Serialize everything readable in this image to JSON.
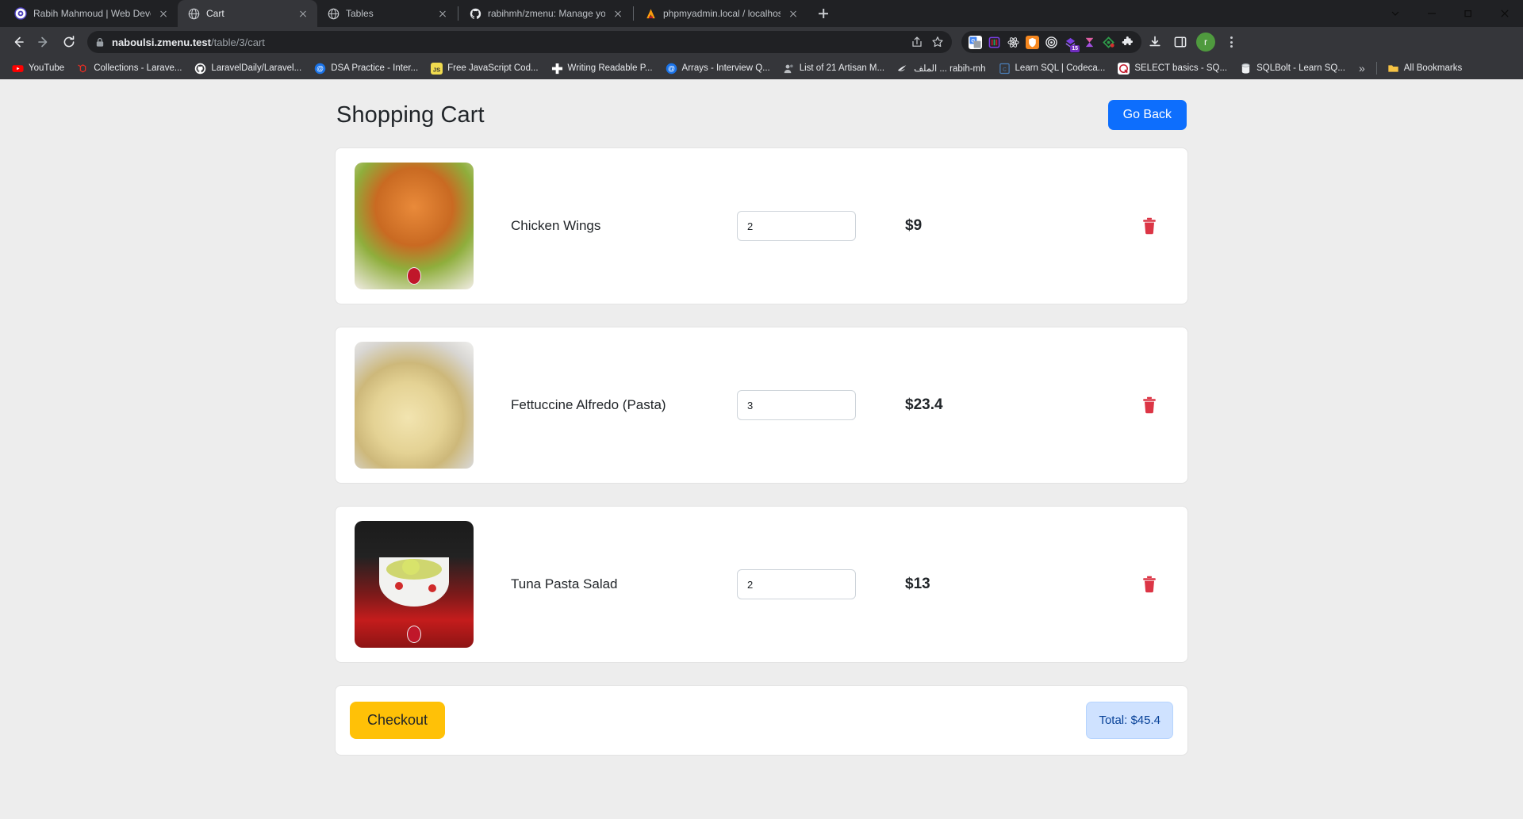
{
  "browser": {
    "tabs": [
      {
        "title": "Rabih Mahmoud | Web Develop",
        "favicon": "globe-purple-icon",
        "active": false
      },
      {
        "title": "Cart",
        "favicon": "globe-icon",
        "active": true
      },
      {
        "title": "Tables",
        "favicon": "globe-icon",
        "active": false
      },
      {
        "title": "rabihmh/zmenu: Manage your re",
        "favicon": "github-icon",
        "active": false
      },
      {
        "title": "phpmyadmin.local / localhost / t",
        "favicon": "phpmyadmin-icon",
        "active": false
      }
    ],
    "new_tab_label": "+",
    "window_controls": [
      "tab-search-chevron",
      "minimize",
      "maximize",
      "close"
    ],
    "nav": {
      "back": "back-arrow",
      "forward": "forward-arrow",
      "reload": "reload-icon"
    },
    "omnibox": {
      "lock": "lock-icon",
      "host": "naboulsi.zmenu.test",
      "path": "/table/3/cart",
      "share_icon": "share-icon",
      "bookmark_icon": "star-icon"
    },
    "extensions": [
      {
        "name": "google-translate-extension",
        "color": "#ffffff",
        "glyph": "G"
      },
      {
        "name": "purple-devtools-extension",
        "color": "#6f2dbd",
        "glyph": ""
      },
      {
        "name": "react-devtools-extension",
        "color": "#20232a",
        "glyph": ""
      },
      {
        "name": "orange-shield-extension",
        "color": "#f5871f",
        "glyph": ""
      },
      {
        "name": "target-ring-extension",
        "color": "#1a1a1a",
        "glyph": ""
      },
      {
        "name": "purple-badge-extension",
        "color": "#7b3fe4",
        "glyph": "",
        "badge": "15"
      },
      {
        "name": "hourglass-extension",
        "color": "#8a4fe0",
        "glyph": ""
      },
      {
        "name": "diamond-dot-extension",
        "color": "#2e7d32",
        "glyph": ""
      },
      {
        "name": "puzzle-extensions-menu",
        "color": "#e8eaed",
        "glyph": ""
      }
    ],
    "toolbar_right": {
      "download_icon": "download-icon",
      "sidepanel_icon": "side-panel-icon",
      "profile_initial": "r",
      "menu_icon": "kebab-menu-icon"
    },
    "bookmarks": [
      {
        "label": "YouTube",
        "icon": "youtube-icon",
        "color": "#ff0000"
      },
      {
        "label": "Collections - Larave...",
        "icon": "laravel-icon",
        "color": "#ff2d20"
      },
      {
        "label": "LaravelDaily/Laravel...",
        "icon": "github-icon",
        "color": "#ffffff"
      },
      {
        "label": "DSA Practice - Inter...",
        "icon": "at-circle-icon",
        "color": "#1a73e8"
      },
      {
        "label": "Free JavaScript Cod...",
        "icon": "javascript-icon",
        "color": "#f0db4f"
      },
      {
        "label": "Writing Readable P...",
        "icon": "plus-square-icon",
        "color": "#ffffff"
      },
      {
        "label": "Arrays - Interview Q...",
        "icon": "at-circle-icon",
        "color": "#1a73e8"
      },
      {
        "label": "List of 21 Artisan M...",
        "icon": "artisan-icon",
        "color": "#b9bcc0"
      },
      {
        "label": "الملف ... rabih-mh",
        "icon": "swirl-icon",
        "color": "#e8eaed"
      },
      {
        "label": "Learn SQL | Codeca...",
        "icon": "codecademy-icon",
        "color": "#4b7fb8"
      },
      {
        "label": "SELECT basics - SQ...",
        "icon": "sqlzoo-icon",
        "color": "#c0172a"
      },
      {
        "label": "SQLBolt - Learn SQ...",
        "icon": "database-icon",
        "color": "#cfd3d7"
      }
    ],
    "bookmarks_overflow": "»",
    "all_bookmarks": {
      "label": "All Bookmarks",
      "icon": "folder-icon",
      "color": "#f6c344"
    }
  },
  "page": {
    "title": "Shopping Cart",
    "go_back_label": "Go Back",
    "accent_blue": "#0d6efd",
    "accent_amber": "#ffc107",
    "accent_danger": "#dc3545",
    "items": [
      {
        "name": "Chicken Wings",
        "quantity": "2",
        "price": "$9",
        "image_name": "chicken-wings-photo",
        "remove_icon": "trash-icon"
      },
      {
        "name": "Fettuccine Alfredo (Pasta)",
        "quantity": "3",
        "price": "$23.4",
        "image_name": "fettuccine-alfredo-photo",
        "remove_icon": "trash-icon"
      },
      {
        "name": "Tuna Pasta Salad",
        "quantity": "2",
        "price": "$13",
        "image_name": "tuna-pasta-salad-photo",
        "remove_icon": "trash-icon"
      }
    ],
    "checkout_label": "Checkout",
    "total_label": "Total: $45.4"
  }
}
